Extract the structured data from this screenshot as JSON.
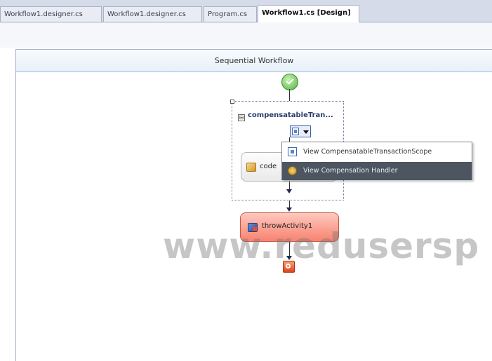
{
  "tabs": [
    {
      "label": "Workflow1.designer.cs",
      "active": false
    },
    {
      "label": "Workflow1.designer.cs",
      "active": false
    },
    {
      "label": "Program.cs",
      "active": false
    },
    {
      "label": "Workflow1.cs [Design]",
      "active": true
    }
  ],
  "workflow": {
    "title": "Sequential Workflow",
    "scope": {
      "title": "compensatableTran...",
      "expander_symbol": "⊟"
    },
    "code_activity": {
      "label": "code"
    },
    "throw_activity": {
      "label": "throwActivity1"
    }
  },
  "context_menu": {
    "items": [
      {
        "label": "View CompensatableTransactionScope",
        "icon": "scope-view-icon",
        "highlighted": false
      },
      {
        "label": "View Compensation Handler",
        "icon": "compensation-handler-icon",
        "highlighted": true
      }
    ]
  },
  "watermark": "www.redusersp",
  "colors": {
    "throw_activity_fill": "#f7826f",
    "menu_highlight": "#4c5560",
    "start_node": "#58b04b",
    "end_node": "#e0401f"
  }
}
